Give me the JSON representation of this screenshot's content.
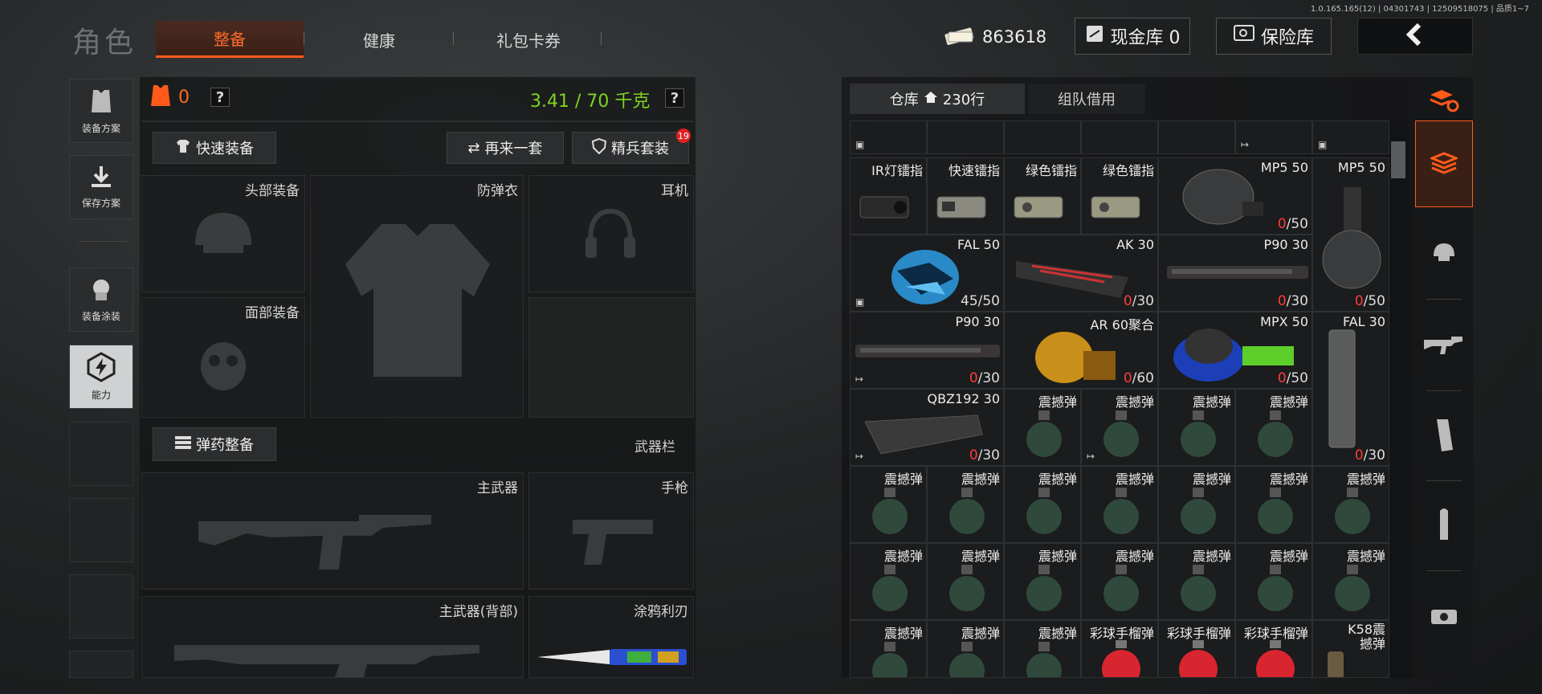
{
  "version": "1.0.165.165(12) | 04301743 | 12509518075 | 品质1~7",
  "header": {
    "title": "角色",
    "tabs": [
      {
        "label": "整备",
        "active": true
      },
      {
        "label": "健康",
        "active": false
      },
      {
        "label": "礼包卡券",
        "active": false
      }
    ],
    "money": "863618",
    "cash_vault": "现金库 0",
    "safe": "保险库"
  },
  "side": {
    "buttons": [
      {
        "label": "装备方案",
        "icon": "vest-icon"
      },
      {
        "label": "保存方案",
        "icon": "download-icon"
      },
      {
        "label": "装备涂装",
        "icon": "paint-icon"
      },
      {
        "label": "能力",
        "icon": "lightning-icon"
      }
    ]
  },
  "equipment": {
    "armor_count": "0",
    "help": "?",
    "weight": "3.41 / 70 千克",
    "quick_equip": "快速装备",
    "again": "再来一套",
    "elite": "精兵套装",
    "elite_badge": "19",
    "slots": {
      "head": "头部装备",
      "armor": "防弹衣",
      "earphone": "耳机",
      "face": "面部装备",
      "primary": "主武器",
      "pistol": "手枪",
      "primary_back": "主武器(背部)",
      "knife": "涂鸦利刃"
    },
    "ammo_prep": "弹药整备",
    "weapon_bar": "武器栏"
  },
  "inventory": {
    "tab_storage": "仓库",
    "storage_count": "230行",
    "tab_team": "组队借用",
    "row1": [
      {
        "name": "IR灯镭指"
      },
      {
        "name": "快速镭指"
      },
      {
        "name": "绿色镭指"
      },
      {
        "name": "绿色镭指"
      },
      {
        "name": "MP5 50",
        "count_zero": "0",
        "count_rest": "/50"
      },
      {
        "name": "MP5 50",
        "count_zero": "0",
        "count_rest": "/50"
      }
    ],
    "row2": [
      {
        "name": "FAL 50",
        "count_plain": "45/50"
      },
      {
        "name": "AK 30",
        "count_zero": "0",
        "count_rest": "/30"
      },
      {
        "name": "P90 30",
        "count_zero": "0",
        "count_rest": "/30"
      },
      {
        "name": "MP5 50",
        "count_zero": "0",
        "count_rest": "/50"
      }
    ],
    "row3": [
      {
        "name": "P90 30",
        "count_zero": "0",
        "count_rest": "/30"
      },
      {
        "name": "AR 60聚合",
        "count_zero": "0",
        "count_rest": "/60"
      },
      {
        "name": "MPX 50",
        "count_zero": "0",
        "count_rest": "/50"
      },
      {
        "name": "FAL 30",
        "count_zero": "0",
        "count_rest": "/30"
      }
    ],
    "row4_first": {
      "name": "QBZ192 30",
      "count_zero": "0",
      "count_rest": "/30"
    },
    "grenade": "震撼弹",
    "paintball": "彩球手榴弹",
    "k58": "K58震撼弹"
  },
  "colors": {
    "accent": "#ff5a1a",
    "zero": "#ff3b3b",
    "weight": "#7ed321"
  }
}
